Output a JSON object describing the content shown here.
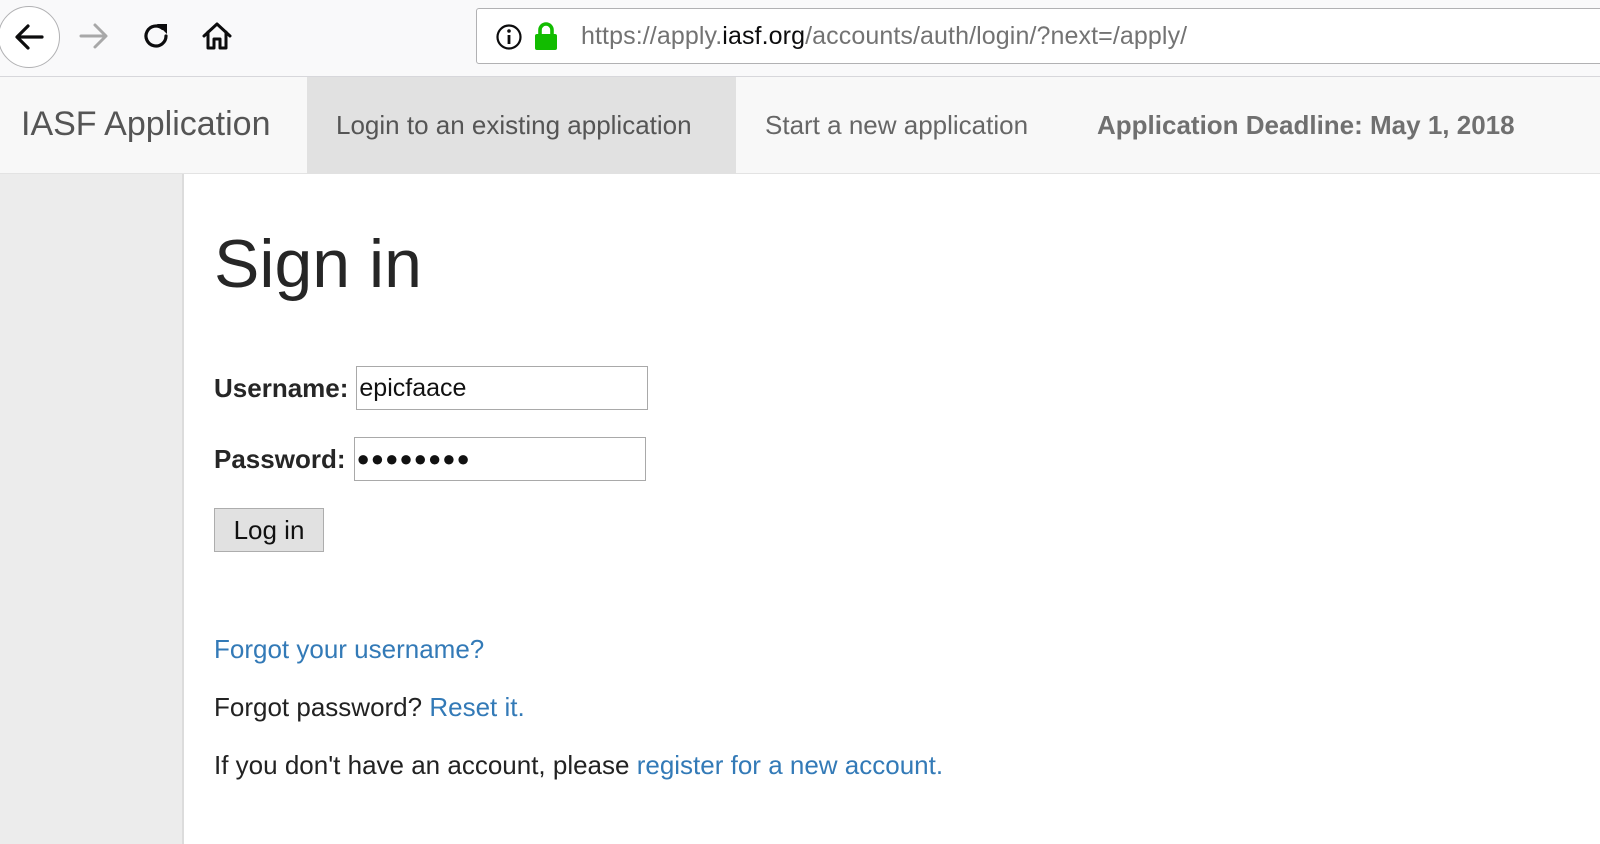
{
  "browser": {
    "url_prefix": "https://apply.",
    "url_domain": "iasf.org",
    "url_path": "/accounts/auth/login/?next=/apply/",
    "lock_color": "#12bc00",
    "icons": [
      "back-arrow-icon",
      "forward-arrow-icon",
      "reload-icon",
      "home-icon",
      "info-icon",
      "lock-icon"
    ]
  },
  "navbar": {
    "brand": "IASF Application",
    "items": [
      {
        "label": "Login to an existing application",
        "active": true
      },
      {
        "label": "Start a new application",
        "active": false
      }
    ],
    "deadline": "Application Deadline: May 1, 2018"
  },
  "main": {
    "title": "Sign in",
    "username_label": "Username:",
    "username_value": "epicfaace",
    "password_label": "Password:",
    "password_masked": "●●●●●●●●",
    "login_button": "Log in",
    "forgot_username_link": "Forgot your username?",
    "forgot_password_text": "Forgot password? ",
    "reset_link": "Reset it.",
    "register_text": "If you don't have an account, please ",
    "register_link": "register for a new account."
  },
  "colors": {
    "link": "#337ab7",
    "nav_active_bg": "#e1e1e1",
    "sidebar_bg": "#ececec"
  }
}
